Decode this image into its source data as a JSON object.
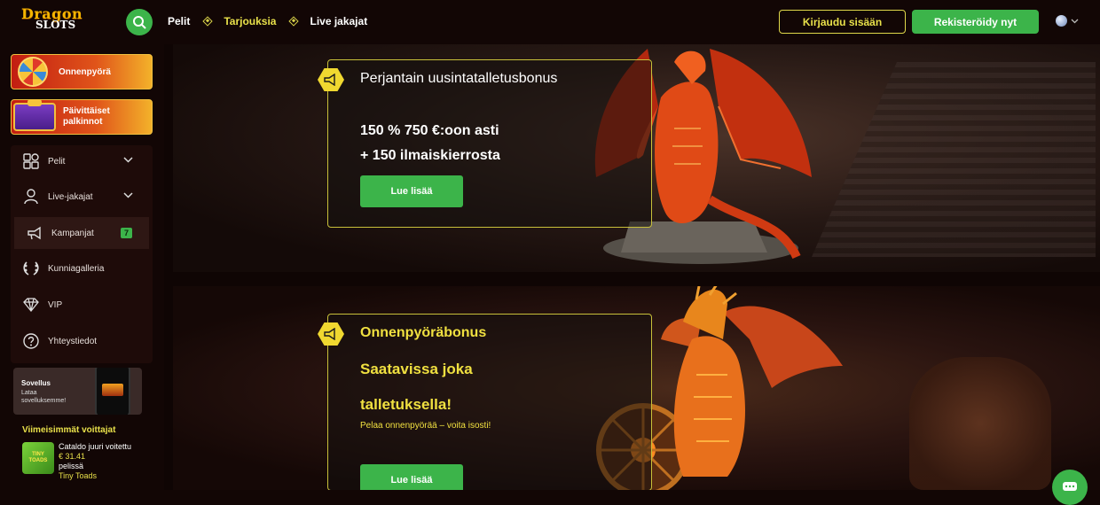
{
  "header": {
    "logo_line1": "Dragon",
    "logo_line2": "SLOTS",
    "nav": [
      "Pelit",
      "Tarjouksia",
      "Live jakajat"
    ],
    "login_label": "Kirjaudu sisään",
    "register_label": "Rekisteröidy nyt",
    "search_icon": "search-icon",
    "language_icon": "globe-icon"
  },
  "sidebar": {
    "promos": [
      "Onnenpyörä",
      "Päivittäiset palkinnot"
    ],
    "items": [
      {
        "label": "Pelit",
        "icon": "games-icon",
        "expandable": true
      },
      {
        "label": "Live-jakajat",
        "icon": "live-dealer-icon",
        "expandable": true
      },
      {
        "label": "Kampanjat",
        "icon": "megaphone-icon",
        "badge": "7",
        "active": true
      },
      {
        "label": "Kunniagalleria",
        "icon": "laurel-icon"
      },
      {
        "label": "VIP",
        "icon": "diamond-icon"
      },
      {
        "label": "Yhteystiedot",
        "icon": "question-icon"
      }
    ],
    "app_card": {
      "title": "Sovellus",
      "text": "Lataa sovelluksemme!"
    },
    "winners_title": "Viimeisimmät voittajat",
    "winner": {
      "name_line": "Cataldo juuri voitettu",
      "amount": "€ 31.41",
      "suffix": "pelissä",
      "game": "Tiny Toads",
      "thumb_text": "TINY TOADS"
    }
  },
  "promotions": [
    {
      "title": "Perjantain uusintatalletusbonus",
      "line1": "150 % 750 €:oon asti",
      "line2": "+ 150 ilmaiskierrosta",
      "cta": "Lue lisää"
    },
    {
      "title": "Onnenpyöräbonus",
      "line1": "Saatavissa joka",
      "line2": "talletuksella!",
      "small": "Pelaa onnenpyörää – voita isosti!",
      "cta": "Lue lisää"
    }
  ],
  "colors": {
    "accent_green": "#3cb44a",
    "accent_yellow": "#e8e04a",
    "background": "#120605"
  }
}
